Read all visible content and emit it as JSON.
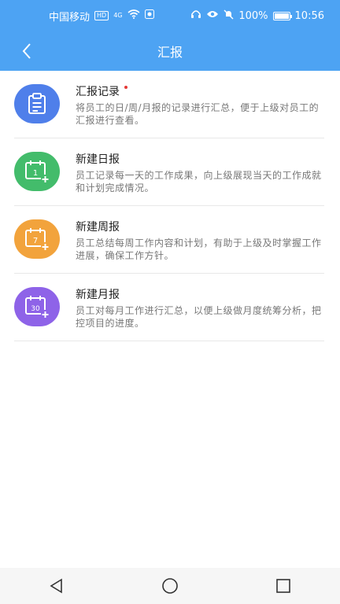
{
  "status": {
    "carrier": "中国移动",
    "hd": "HD",
    "net": "4G",
    "battery": "100%",
    "time": "10:56"
  },
  "header": {
    "title": "汇报"
  },
  "items": [
    {
      "title": "汇报记录",
      "desc": "将员工的日/周/月报的记录进行汇总，便于上级对员工的汇报进行查看。",
      "color": "#4F7FEA",
      "icon_label": "",
      "icon": "clipboard-icon",
      "has_dot": true
    },
    {
      "title": "新建日报",
      "desc": "员工记录每一天的工作成果，向上级展现当天的工作成就和计划完成情况。",
      "color": "#43BC6B",
      "icon_label": "1",
      "icon": "calendar-add-icon"
    },
    {
      "title": "新建周报",
      "desc": "员工总结每周工作内容和计划，有助于上级及时掌握工作进展，确保工作方针。",
      "color": "#F2A33C",
      "icon_label": "7",
      "icon": "calendar-add-icon"
    },
    {
      "title": "新建月报",
      "desc": "员工对每月工作进行汇总，以便上级做月度统筹分析，把控项目的进度。",
      "color": "#8E63E8",
      "icon_label": "30",
      "icon": "calendar-add-icon"
    }
  ],
  "colors": {
    "primary": "#4DA3F3"
  }
}
